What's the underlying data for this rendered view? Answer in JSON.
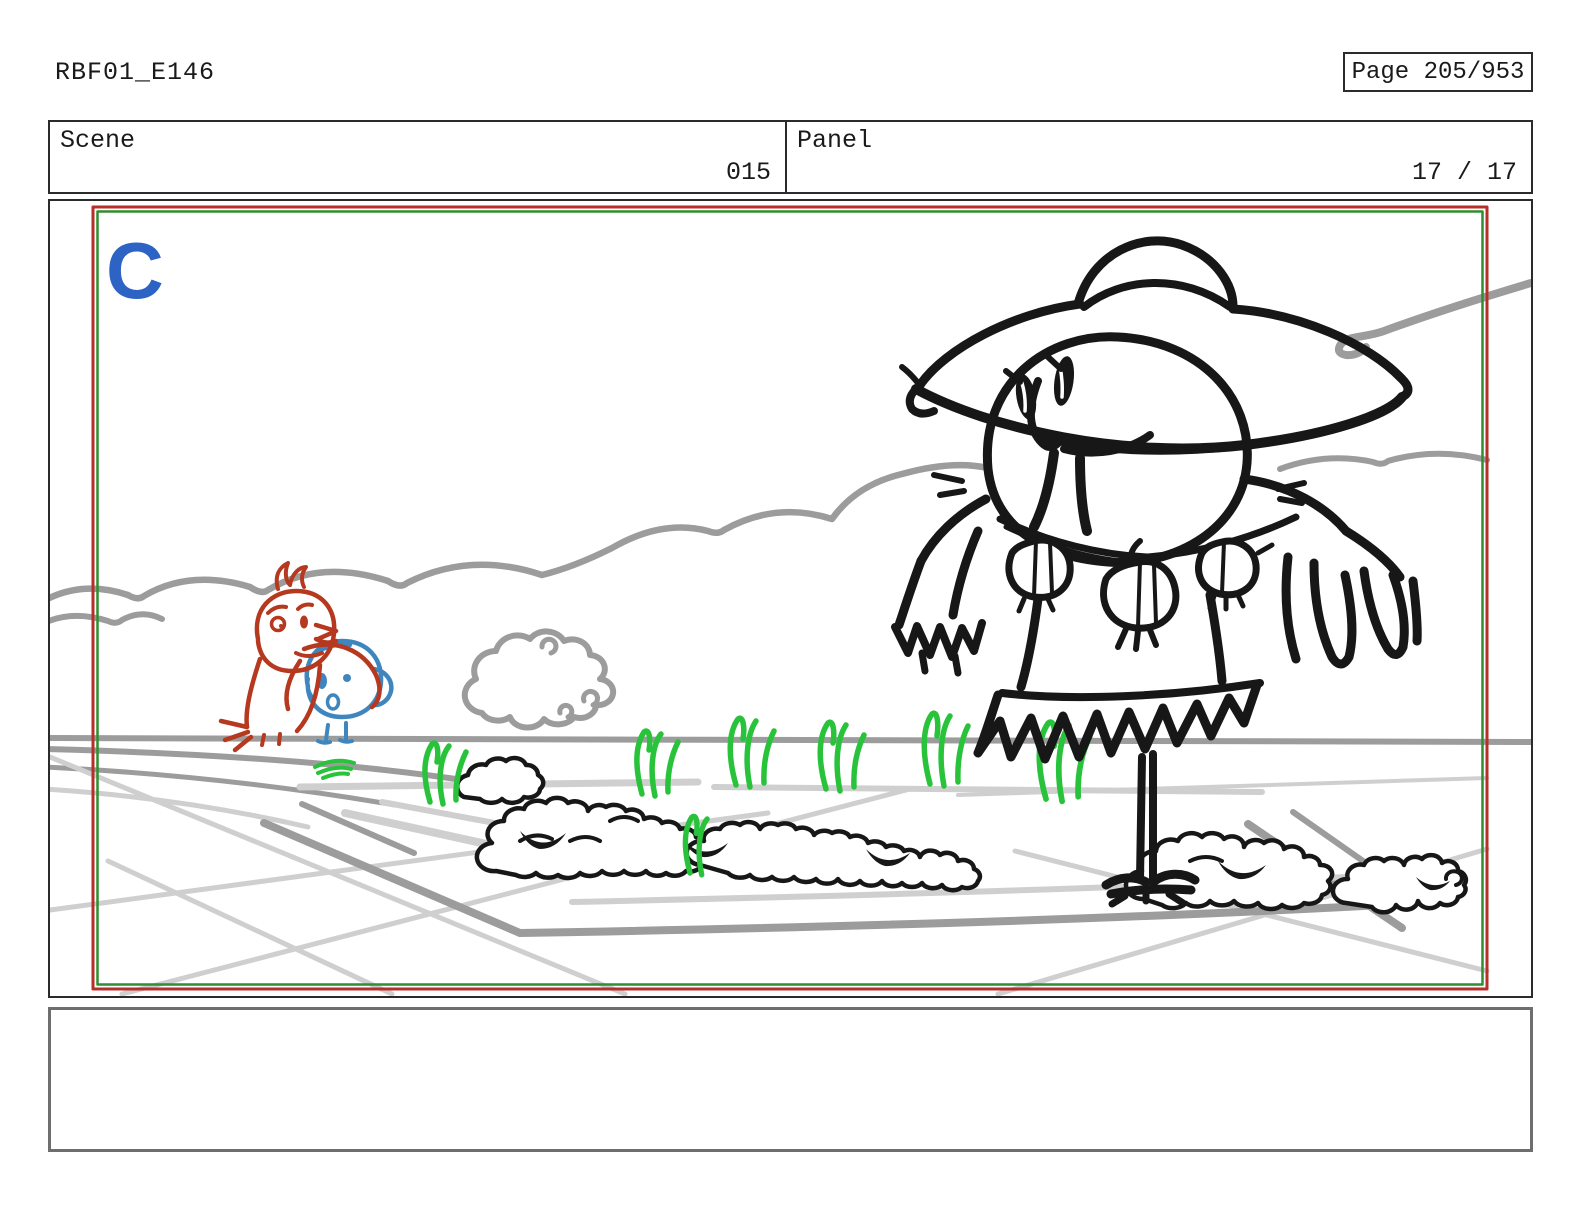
{
  "colors": {
    "frame-red": "#b52f2b",
    "frame-green": "#2f8e2f",
    "label-blue": "#2c63c5",
    "ink": "#171717",
    "sketch-gray": "#9c9c9c",
    "sketch-gray-light": "#cfcfcf",
    "grass-green": "#28c33a",
    "bird-red": "#b5381f",
    "bird-blue": "#3f86be"
  },
  "header": {
    "board_id": "RBF01_E146",
    "page_label": "Page 205/953"
  },
  "info": {
    "scene_label": "Scene",
    "scene_value": "015",
    "panel_label": "Panel",
    "panel_value": "17 / 17"
  },
  "board": {
    "camera_label": "C"
  },
  "notes": {
    "text": ""
  }
}
